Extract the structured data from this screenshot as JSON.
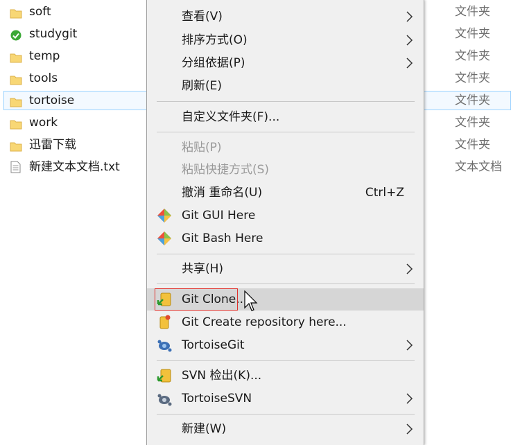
{
  "files": [
    {
      "name": "soft",
      "type": "文件夹",
      "icon": "folder-icon"
    },
    {
      "name": "studygit",
      "type": "文件夹",
      "icon": "git-clean-folder-icon"
    },
    {
      "name": "temp",
      "type": "文件夹",
      "icon": "folder-icon"
    },
    {
      "name": "tools",
      "type": "文件夹",
      "icon": "folder-icon"
    },
    {
      "name": "tortoise",
      "type": "文件夹",
      "icon": "folder-icon",
      "selected": true
    },
    {
      "name": "work",
      "type": "文件夹",
      "icon": "folder-icon"
    },
    {
      "name": "迅雷下载",
      "type": "文件夹",
      "icon": "folder-icon"
    },
    {
      "name": "新建文本文档.txt",
      "type": "文本文档",
      "icon": "text-file-icon"
    }
  ],
  "menu": {
    "view": "查看(V)",
    "sort": "排序方式(O)",
    "group": "分组依据(P)",
    "refresh": "刷新(E)",
    "customize": "自定义文件夹(F)...",
    "paste": "粘贴(P)",
    "paste_shortcut": "粘贴快捷方式(S)",
    "undo": "撤消 重命名(U)",
    "undo_shortcut": "Ctrl+Z",
    "git_gui": "Git GUI Here",
    "git_bash": "Git Bash Here",
    "share": "共享(H)",
    "git_clone": "Git Clone...",
    "git_create": "Git Create repository here...",
    "tortoisegit": "TortoiseGit",
    "svn_checkout": "SVN 检出(K)...",
    "tortoisesvn": "TortoiseSVN",
    "new": "新建(W)"
  },
  "colors": {
    "folder": "#f8d775",
    "menu_bg": "#f0f0f0",
    "hover": "#d6d6d6",
    "highlight_border": "#e0302b",
    "selection": "#99d1ff"
  }
}
